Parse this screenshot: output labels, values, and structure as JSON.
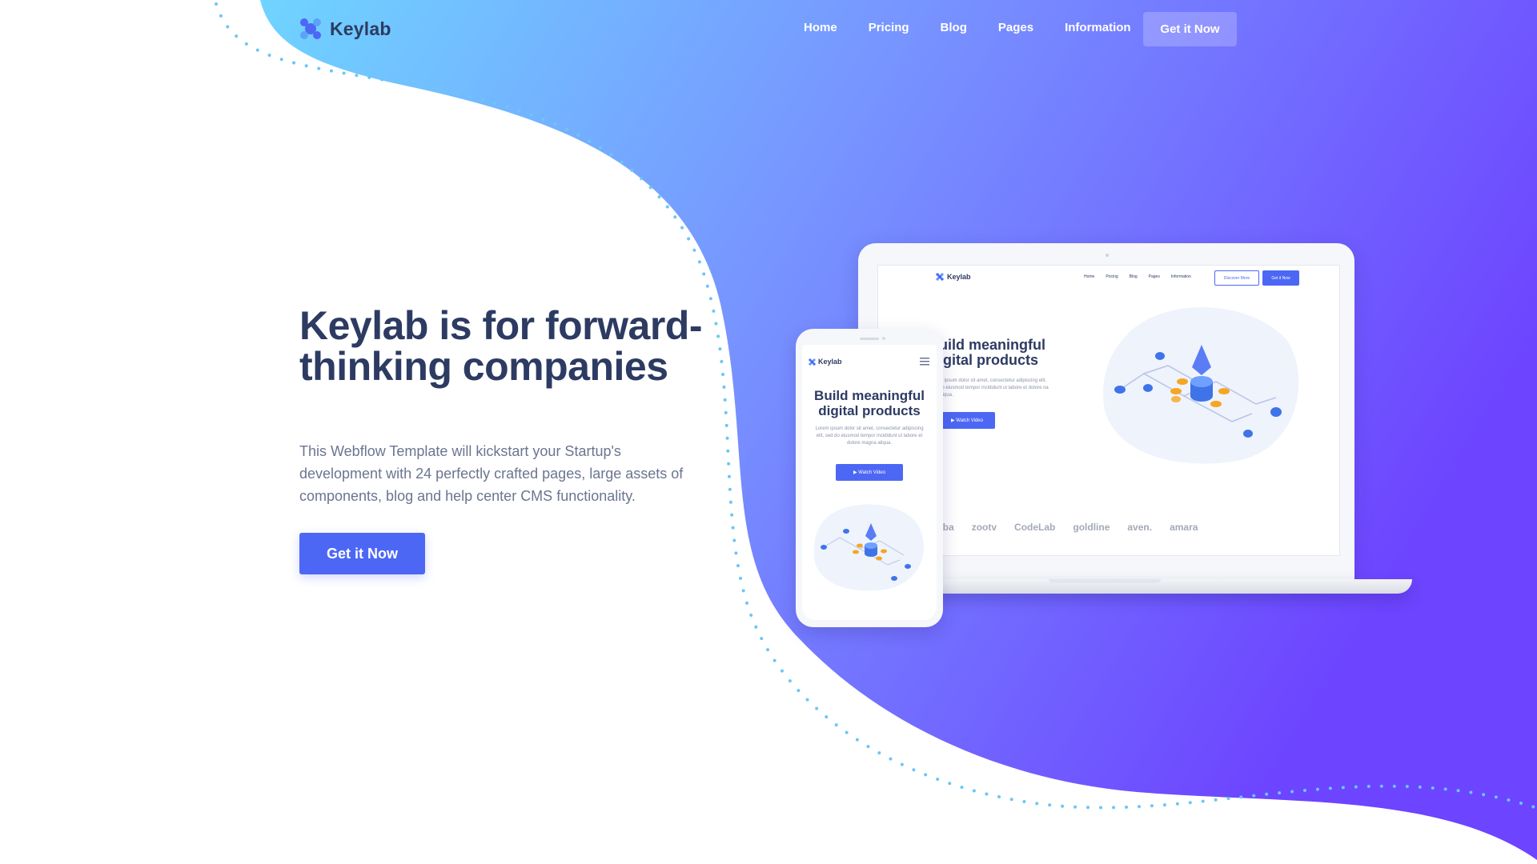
{
  "colors": {
    "gradient_start": "#6fd4ff",
    "gradient_end": "#6d44ff",
    "primary": "#4d67f5",
    "heading": "#2d3b63",
    "body_text": "#6b7590",
    "dots": "#6cc6f4"
  },
  "nav": {
    "brand": "Keylab",
    "brand_icon": "puzzle-logo-icon",
    "items": [
      "Home",
      "Pricing",
      "Blog",
      "Pages",
      "Information"
    ],
    "cta": "Get it Now"
  },
  "hero": {
    "title": "Keylab is for forward-thinking companies",
    "subtitle": "This Webflow Template will kickstart your Startup's development with 24 perfectly crafted pages, large assets of components, blog and help center CMS functionality.",
    "cta": "Get it Now"
  },
  "laptop_preview": {
    "brand": "Keylab",
    "menu": [
      "Home",
      "Pricing",
      "Blog",
      "Pages",
      "Information"
    ],
    "secondary_button": "Discover More",
    "primary_button": "Get it Now",
    "title": "uild meaningful igital products",
    "text": "m ipsum dolor sit amet, consectetur adipiscing elit, do eiusmod tempor incididunt ut labore et dolore na aliqua.",
    "watch_button": "Watch Video",
    "logos": [
      "kanba",
      "zootv",
      "CodeLab",
      "goldline",
      "aven.",
      "amara"
    ]
  },
  "phone_preview": {
    "brand": "Keylab",
    "menu_icon": "hamburger-icon",
    "title": "Build meaningful digital products",
    "text": "Lorem ipsum dolor sit amet, consectetur adipiscing elit, sed do eiusmod tempor incididunt ut labore et dolore magna aliqua.",
    "watch_button": "Watch Video"
  }
}
